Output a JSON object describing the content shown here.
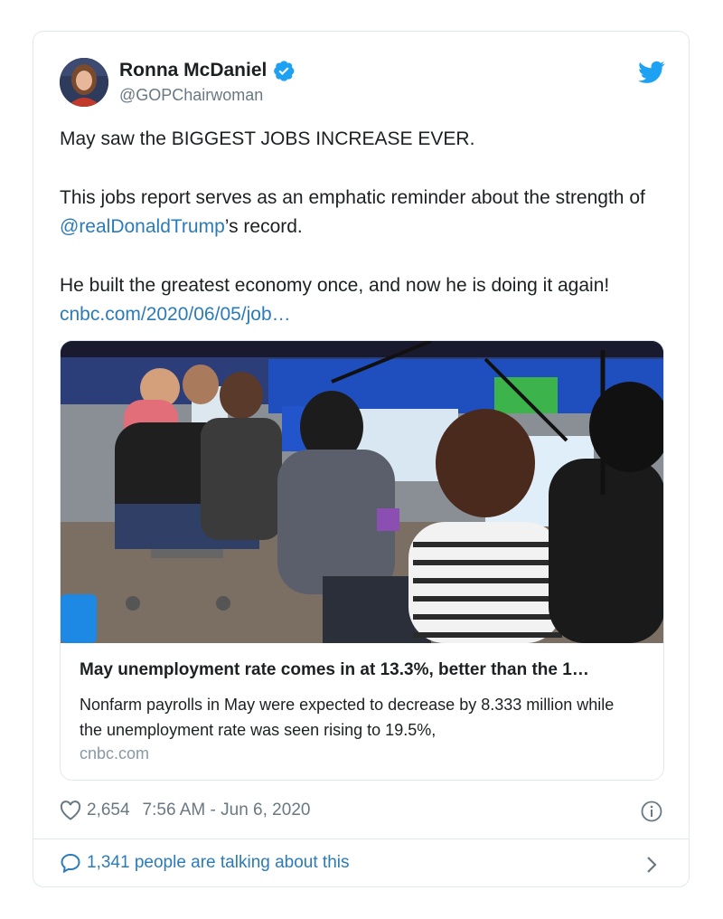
{
  "author": {
    "name": "Ronna McDaniel",
    "handle": "@GOPChairwoman"
  },
  "tweet": {
    "line1": "May saw the BIGGEST JOBS INCREASE EVER.",
    "p2_pre": "This jobs report serves as an emphatic reminder about the strength of ",
    "p2_mention": "@realDonaldTrump",
    "p2_post": "’s record.",
    "p3_pre": "He built the greatest economy once, and now he is doing it again! ",
    "p3_link": "cnbc.com/2020/06/05/job…"
  },
  "link_card": {
    "title": "May unemployment rate comes in at 13.3%, better than the 1…",
    "description": "Nonfarm payrolls in May were expected to decrease by 8.333 million while the unemployment rate was seen rising to 19.5%,",
    "domain": "cnbc.com",
    "image_icon": "photo-call-center-workers"
  },
  "meta": {
    "likes": "2,654",
    "timestamp": "7:56 AM - Jun 6, 2020"
  },
  "footer": {
    "talking": "1,341 people are talking about this"
  },
  "icons": {
    "heart": "heart-icon",
    "info": "info-icon",
    "bird": "twitter-bird-icon",
    "verified": "verified-badge-icon",
    "bubble": "speech-bubble-icon",
    "chevron": "chevron-right-icon"
  },
  "colors": {
    "link": "#2b7bb9",
    "verified": "#1da1f2",
    "bird": "#1da1f2",
    "muted": "#697882"
  }
}
